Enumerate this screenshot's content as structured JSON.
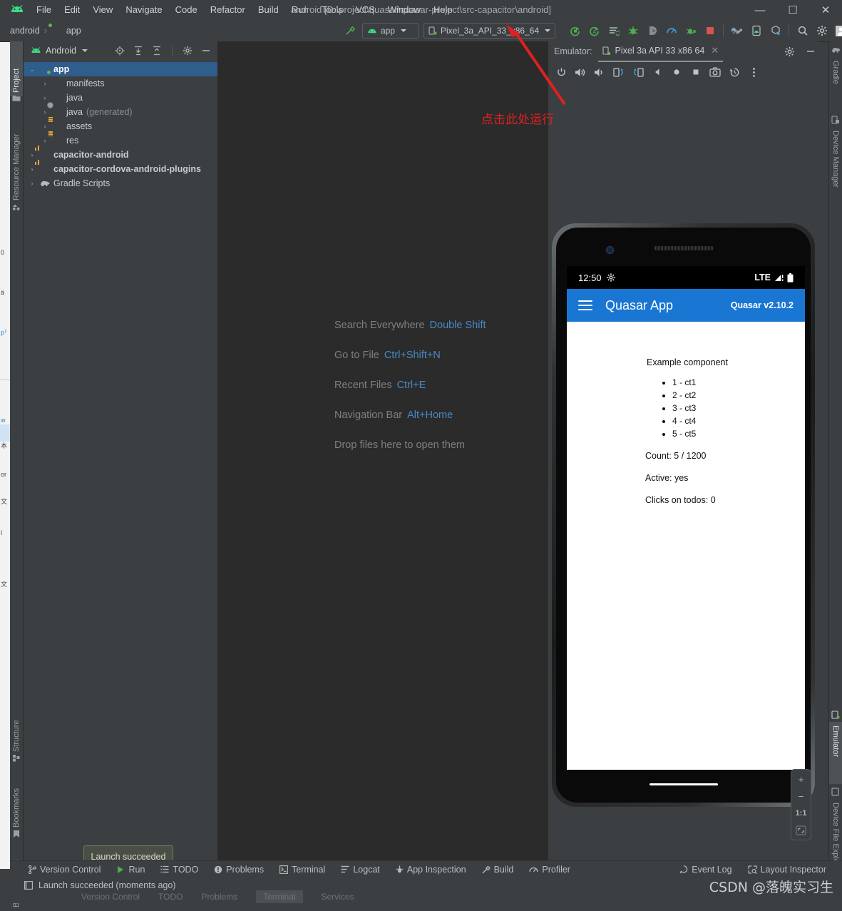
{
  "window": {
    "title": "android [D:\\project\\quasar\\quasar-project\\src-capacitor\\android]",
    "minimize": "—",
    "maximize": "☐",
    "close": "✕"
  },
  "menu": [
    "File",
    "Edit",
    "View",
    "Navigate",
    "Code",
    "Refactor",
    "Build",
    "Run",
    "Tools",
    "VCS",
    "Window",
    "Help"
  ],
  "navbar": {
    "breadcrumb_root": "android",
    "breadcrumb_sep": "›",
    "breadcrumb_module": "app",
    "run_config": "app",
    "device": "Pixel_3a_API_33_x86_64",
    "icons": [
      "run-icon",
      "run-with-coverage-icon",
      "apply-changes-icon",
      "debug-icon",
      "attach-debugger-icon",
      "profiler-icon",
      "profile-app-icon",
      "stop-icon",
      "sdk-manager-icon",
      "avd-manager-icon",
      "sync-gradle-icon",
      "search-icon",
      "settings-gear-icon",
      "account-avatar-icon"
    ]
  },
  "left_strip": {
    "top": [
      {
        "label": "Project",
        "icon": "project-icon",
        "selected": true
      },
      {
        "label": "Resource Manager",
        "icon": "resource-manager-icon",
        "selected": false
      }
    ],
    "bottom": [
      {
        "label": "Structure",
        "icon": "structure-icon"
      },
      {
        "label": "Bookmarks",
        "icon": "bookmark-icon"
      },
      {
        "label": "Build Variants",
        "icon": "build-variants-icon"
      }
    ]
  },
  "right_strip": {
    "top": [
      {
        "label": "Gradle",
        "icon": "gradle-elephant-icon"
      },
      {
        "label": "Device Manager",
        "icon": "device-manager-icon"
      }
    ],
    "bottom": [
      {
        "label": "Emulator",
        "icon": "emulator-icon",
        "selected": true
      },
      {
        "label": "Device File Explorer",
        "icon": "device-file-explorer-icon"
      }
    ]
  },
  "project_panel": {
    "title": "Android",
    "toolbar_icons": [
      "select-opened-file-icon",
      "expand-all-icon",
      "collapse-all-icon",
      "settings-gear-icon",
      "hide-icon"
    ],
    "tree": [
      {
        "label": "app",
        "icon": "module-folder-icon",
        "depth": 0,
        "arrow": "⌄",
        "selected": true,
        "bold": true
      },
      {
        "label": "manifests",
        "icon": "folder-icon",
        "depth": 1,
        "arrow": "›",
        "selected": false,
        "bold": false
      },
      {
        "label": "java",
        "icon": "folder-icon",
        "depth": 1,
        "arrow": "›",
        "selected": false,
        "bold": false
      },
      {
        "label": "java",
        "suffix": "(generated)",
        "icon": "generated-folder-icon",
        "depth": 1,
        "arrow": "›",
        "selected": false,
        "bold": false
      },
      {
        "label": "assets",
        "icon": "res-folder-icon",
        "depth": 1,
        "arrow": "›",
        "selected": false,
        "bold": false
      },
      {
        "label": "res",
        "icon": "res-folder-icon",
        "depth": 1,
        "arrow": "›",
        "selected": false,
        "bold": false
      },
      {
        "label": "capacitor-android",
        "icon": "library-module-icon",
        "depth": 0,
        "arrow": "›",
        "selected": false,
        "bold": true
      },
      {
        "label": "capacitor-cordova-android-plugins",
        "icon": "library-module-icon",
        "depth": 0,
        "arrow": "›",
        "selected": false,
        "bold": true
      },
      {
        "label": "Gradle Scripts",
        "icon": "gradle-elephant-icon",
        "depth": 0,
        "arrow": "›",
        "selected": false,
        "bold": false
      }
    ]
  },
  "editor_hints": [
    {
      "label": "Search Everywhere",
      "key": "Double Shift"
    },
    {
      "label": "Go to File",
      "key": "Ctrl+Shift+N"
    },
    {
      "label": "Recent Files",
      "key": "Ctrl+E"
    },
    {
      "label": "Navigation Bar",
      "key": "Alt+Home"
    },
    {
      "label": "Drop files here to open them",
      "key": ""
    }
  ],
  "emulator_panel": {
    "label": "Emulator:",
    "tab": "Pixel 3a API 33 x86 64",
    "tab_close": "✕",
    "header_icons": [
      "settings-gear-icon",
      "hide-icon"
    ],
    "toolbar_icons": [
      "power-icon",
      "volume-up-icon",
      "volume-down-icon",
      "rotate-left-icon",
      "rotate-right-icon",
      "back-icon",
      "home-icon",
      "overview-icon",
      "screenshot-icon",
      "history-icon",
      "more-icon"
    ],
    "zoom_controls": {
      "zoom_in": "+",
      "zoom_out": "−",
      "actual_size": "1:1",
      "fit": "fit-screen-icon"
    }
  },
  "device_screen": {
    "status_bar": {
      "time": "12:50",
      "left_icon": "settings-gear-icon",
      "network": "LTE",
      "signal_icon": "signal-icon",
      "battery_icon": "battery-icon"
    },
    "app_bar": {
      "menu_icon": "hamburger-menu-icon",
      "title": "Quasar App",
      "version": "Quasar v2.10.2",
      "color": "#1976d2"
    },
    "content": {
      "heading": "Example component",
      "list": [
        "1 - ct1",
        "2 - ct2",
        "3 - ct3",
        "4 - ct4",
        "5 - ct5"
      ],
      "count": "Count: 5 / 1200",
      "active": "Active: yes",
      "clicks": "Clicks on todos: 0"
    }
  },
  "annotation": {
    "text": "点击此处运行",
    "color": "#e02020",
    "arrow": "red-arrow-pointing-to-run-button"
  },
  "tooltip": {
    "text": "Launch succeeded"
  },
  "status_bar_tabs": [
    {
      "label": "Version Control",
      "icon": "branch-icon"
    },
    {
      "label": "Run",
      "icon": "run-icon"
    },
    {
      "label": "TODO",
      "icon": "todo-icon"
    },
    {
      "label": "Problems",
      "icon": "problems-icon"
    },
    {
      "label": "Terminal",
      "icon": "terminal-icon"
    },
    {
      "label": "Logcat",
      "icon": "logcat-icon"
    },
    {
      "label": "App Inspection",
      "icon": "app-inspection-icon"
    },
    {
      "label": "Build",
      "icon": "build-hammer-icon"
    },
    {
      "label": "Profiler",
      "icon": "profiler-icon"
    }
  ],
  "status_bar_right": [
    {
      "label": "Event Log",
      "icon": "event-log-icon"
    },
    {
      "label": "Layout Inspector",
      "icon": "layout-inspector-icon"
    }
  ],
  "bottom_message": {
    "icon": "message-icon",
    "text": "Launch succeeded (moments ago)"
  },
  "behind_bar_tabs": [
    "Version Control",
    "TODO",
    "Problems",
    "Terminal",
    "Services"
  ],
  "watermark": {
    "prefix": "CSDN @",
    "text": "落魄实习生"
  },
  "behind_window_lines": [
    "0",
    "ä",
    "pᵀ",
    "w",
    "本",
    "or",
    "文",
    "l",
    "文"
  ]
}
